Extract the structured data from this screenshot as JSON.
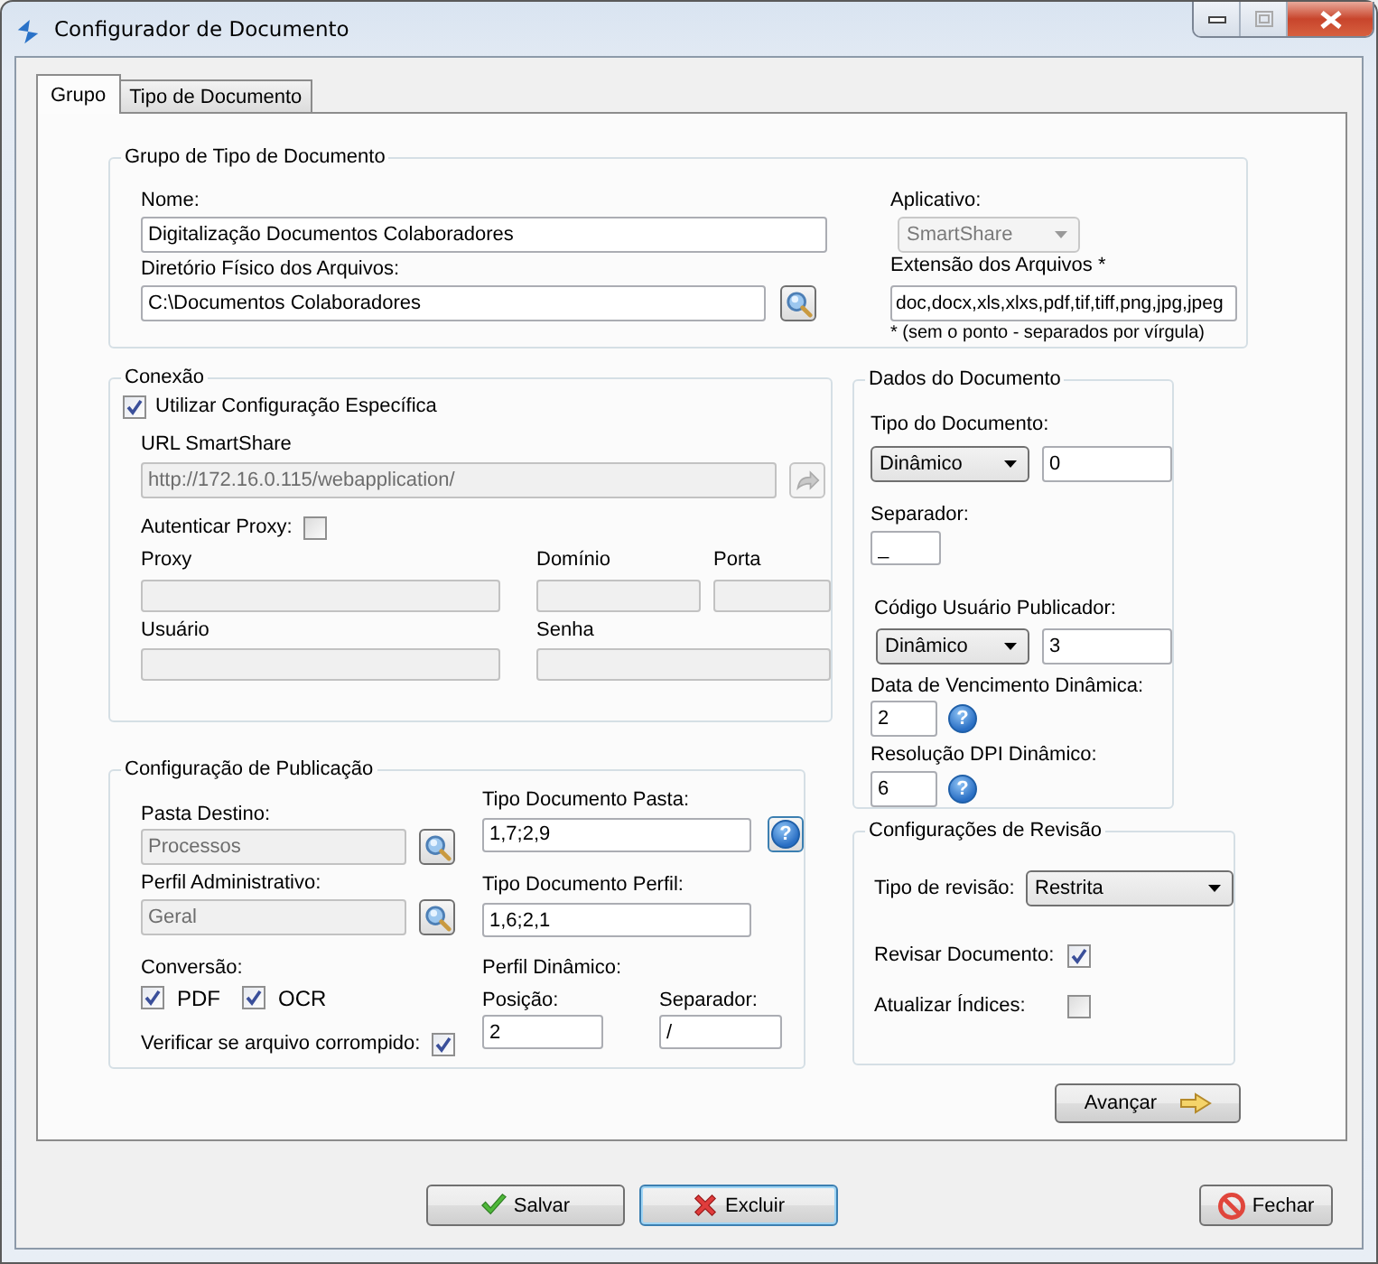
{
  "window": {
    "title": "Configurador de Documento"
  },
  "tabs": [
    {
      "label": "Grupo",
      "selected": true
    },
    {
      "label": "Tipo de Documento",
      "selected": false
    }
  ],
  "grupo": {
    "title": "Grupo de Tipo de Documento",
    "nome": {
      "label": "Nome:",
      "value": "Digitalização Documentos Colaboradores"
    },
    "diretorio": {
      "label": "Diretório Físico dos Arquivos:",
      "value": "C:\\Documentos Colaboradores"
    },
    "aplicativo": {
      "label": "Aplicativo:",
      "value": "SmartShare",
      "disabled": true
    },
    "extensao": {
      "label": "Extensão dos Arquivos *",
      "value": "doc,docx,xls,xlxs,pdf,tif,tiff,png,jpg,jpeg",
      "note": "* (sem o ponto - separados por vírgula)"
    }
  },
  "conexao": {
    "title": "Conexão",
    "especifica": {
      "label": "Utilizar Configuração Específica",
      "checked": true
    },
    "url": {
      "label": "URL SmartShare",
      "value": "http://172.16.0.115/webapplication/",
      "disabled": true
    },
    "proxy_auth": {
      "label": "Autenticar Proxy:",
      "checked": false
    },
    "proxy": {
      "label": "Proxy",
      "disabled": true
    },
    "dominio": {
      "label": "Domínio",
      "disabled": true
    },
    "porta": {
      "label": "Porta",
      "disabled": true
    },
    "usuario": {
      "label": "Usuário",
      "disabled": true
    },
    "senha": {
      "label": "Senha",
      "disabled": true
    }
  },
  "publicacao": {
    "title": "Configuração de Publicação",
    "pasta_destino": {
      "label": "Pasta Destino:",
      "value": "Processos",
      "disabled": true
    },
    "perfil_admin": {
      "label": "Perfil Administrativo:",
      "value": "Geral",
      "disabled": true
    },
    "conversao": {
      "label": "Conversão:",
      "options": [
        {
          "label": "PDF",
          "checked": true
        },
        {
          "label": "OCR",
          "checked": true
        }
      ]
    },
    "verificar": {
      "label": "Verificar se arquivo corrompido:",
      "checked": true
    },
    "tipo_pasta": {
      "label": "Tipo Documento Pasta:",
      "value": "1,7;2,9",
      "help": "?"
    },
    "tipo_perfil": {
      "label": "Tipo Documento Perfil:",
      "value": "1,6;2,1"
    },
    "perfil_dinamico": {
      "label": "Perfil Dinâmico:",
      "posicao": {
        "label": "Posição:",
        "value": "2"
      },
      "separador": {
        "label": "Separador:",
        "value": "/"
      }
    }
  },
  "dados": {
    "title": "Dados do Documento",
    "tipo": {
      "label": "Tipo do Documento:",
      "mode": "Dinâmico",
      "value": "0"
    },
    "separador": {
      "label": "Separador:",
      "value": "_"
    },
    "codigo_usuario": {
      "label": "Código Usuário Publicador:",
      "mode": "Dinâmico",
      "value": "3"
    },
    "data_vencimento": {
      "label": "Data de Vencimento Dinâmica:",
      "value": "2",
      "help": "?"
    },
    "resolucao_dpi": {
      "label": "Resolução DPI Dinâmico:",
      "value": "6",
      "help": "?"
    }
  },
  "revisao": {
    "title": "Configurações de Revisão",
    "tipo": {
      "label": "Tipo de revisão:",
      "value": "Restrita"
    },
    "revisar": {
      "label": "Revisar Documento:",
      "checked": true
    },
    "atualizar_indices": {
      "label": "Atualizar Índices:",
      "checked": false
    }
  },
  "avancar": "Avançar",
  "buttons": [
    {
      "label": "Salvar",
      "kind": "save",
      "focused": false
    },
    {
      "label": "Excluir",
      "kind": "delete",
      "focused": true
    },
    {
      "label": "Fechar",
      "kind": "close",
      "focused": false
    }
  ]
}
